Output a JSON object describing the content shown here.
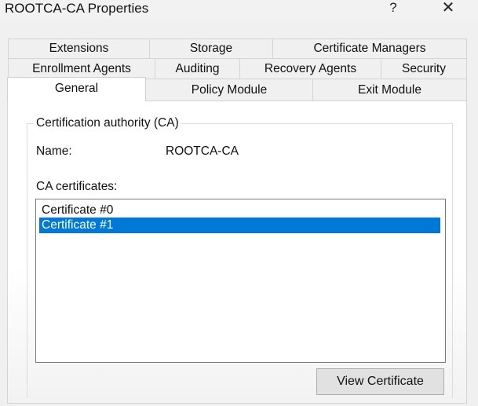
{
  "window": {
    "title": "ROOTCA-CA Properties",
    "help_glyph": "?",
    "close_glyph": "✕"
  },
  "tabs": {
    "row1": [
      "Extensions",
      "Storage",
      "Certificate Managers"
    ],
    "row2": [
      "Enrollment Agents",
      "Auditing",
      "Recovery Agents",
      "Security"
    ],
    "row3": [
      "General",
      "Policy Module",
      "Exit Module"
    ],
    "active": "General"
  },
  "general": {
    "group_title": "Certification authority (CA)",
    "name_label": "Name:",
    "name_value": "ROOTCA-CA",
    "ca_certificates_label": "CA certificates:",
    "certificates": [
      "Certificate #0",
      "Certificate #1"
    ],
    "selected_certificate": "Certificate #1",
    "view_certificate_button": "View Certificate"
  },
  "colors": {
    "selection": "#0078d7",
    "window_bg": "#f0f0f0",
    "panel_bg": "#ffffff"
  }
}
